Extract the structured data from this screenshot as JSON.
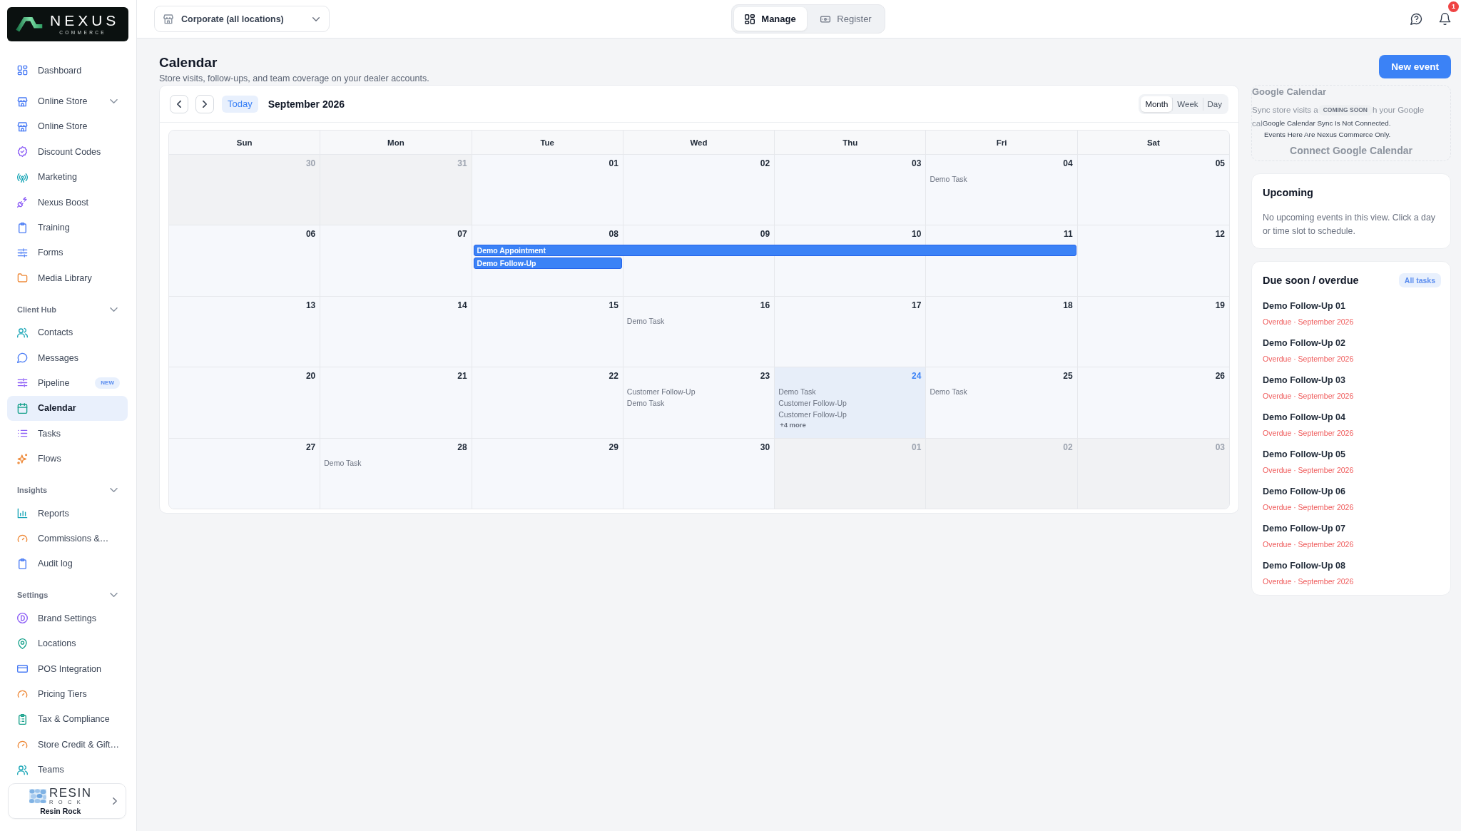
{
  "sidebar": {
    "logo": {
      "name": "NEXUS",
      "tagline": "COMMERCE"
    },
    "groups": [
      {
        "kind": "plain",
        "items": [
          {
            "label": "Dashboard",
            "selected": false
          }
        ]
      },
      {
        "kind": "menu",
        "label": "Online Store",
        "expanded": true,
        "items": [
          {
            "label": "Online Store",
            "selected": false
          },
          {
            "label": "Discount Codes",
            "selected": false
          },
          {
            "label": "Marketing",
            "selected": false
          },
          {
            "label": "Nexus Boost",
            "selected": false
          },
          {
            "label": "Training",
            "selected": false
          },
          {
            "label": "Forms",
            "selected": false
          },
          {
            "label": "Media Library",
            "selected": false
          }
        ]
      },
      {
        "kind": "section",
        "label": "Client Hub",
        "expanded": true,
        "items": [
          {
            "label": "Contacts",
            "selected": false
          },
          {
            "label": "Messages",
            "selected": false
          },
          {
            "label": "Pipeline",
            "selected": false,
            "badge": "NEW"
          },
          {
            "label": "Calendar",
            "selected": true
          },
          {
            "label": "Tasks",
            "selected": false
          },
          {
            "label": "Flows",
            "selected": false
          }
        ]
      },
      {
        "kind": "section",
        "label": "Insights",
        "expanded": true,
        "items": [
          {
            "label": "Reports",
            "selected": false
          },
          {
            "label": "Commissions &…",
            "selected": false
          },
          {
            "label": "Audit log",
            "selected": false
          }
        ]
      },
      {
        "kind": "section",
        "label": "Settings",
        "expanded": true,
        "items": [
          {
            "label": "Brand Settings",
            "selected": false
          },
          {
            "label": "Locations",
            "selected": false
          },
          {
            "label": "POS Integration",
            "selected": false
          },
          {
            "label": "Pricing Tiers",
            "selected": false
          },
          {
            "label": "Tax & Compliance",
            "selected": false
          },
          {
            "label": "Store Credit & Gift…",
            "selected": false
          },
          {
            "label": "Teams",
            "selected": false
          }
        ]
      }
    ],
    "account": {
      "logo_name": "RESIN",
      "logo_tagline": "ROCK",
      "name": "Resin Rock"
    }
  },
  "topbar": {
    "location": "Corporate (all locations)",
    "modes": [
      {
        "label": "Manage",
        "selected": true
      },
      {
        "label": "Register",
        "selected": false
      }
    ],
    "notifications": "1"
  },
  "page": {
    "title": "Calendar",
    "subtitle": "Store visits, follow-ups, and team coverage on your dealer accounts.",
    "new_button": "New event"
  },
  "calendar": {
    "today_button": "Today",
    "month_label": "September 2026",
    "views": [
      {
        "label": "Month",
        "selected": true
      },
      {
        "label": "Week",
        "selected": false
      },
      {
        "label": "Day",
        "selected": false
      }
    ],
    "weekdays": [
      "Sun",
      "Mon",
      "Tue",
      "Wed",
      "Thu",
      "Fri",
      "Sat"
    ],
    "weeks": [
      {
        "days": [
          {
            "date": "30",
            "outside": true,
            "today": false
          },
          {
            "date": "31",
            "outside": true,
            "today": false
          },
          {
            "date": "01",
            "outside": false,
            "today": false
          },
          {
            "date": "02",
            "outside": false,
            "today": false
          },
          {
            "date": "03",
            "outside": false,
            "today": false
          },
          {
            "date": "04",
            "outside": false,
            "today": false,
            "events": [
              "Demo Task"
            ]
          },
          {
            "date": "05",
            "outside": false,
            "today": false
          }
        ]
      },
      {
        "days": [
          {
            "date": "06",
            "outside": false,
            "today": false
          },
          {
            "date": "07",
            "outside": false,
            "today": false
          },
          {
            "date": "08",
            "outside": false,
            "today": false
          },
          {
            "date": "09",
            "outside": false,
            "today": false
          },
          {
            "date": "10",
            "outside": false,
            "today": false
          },
          {
            "date": "11",
            "outside": false,
            "today": false
          },
          {
            "date": "12",
            "outside": false,
            "today": false
          }
        ],
        "lanes": [
          {
            "slots": [
              {
                "kind": "free"
              },
              {
                "kind": "free"
              },
              {
                "kind": "bar",
                "title": "Demo Appointment"
              },
              {
                "kind": "cont"
              },
              {
                "kind": "cont"
              },
              {
                "kind": "cont"
              },
              {
                "kind": "free"
              }
            ]
          },
          {
            "slots": [
              {
                "kind": "free"
              },
              {
                "kind": "free"
              },
              {
                "kind": "bar",
                "title": "Demo Follow-Up"
              },
              {
                "kind": "free"
              },
              {
                "kind": "free"
              },
              {
                "kind": "free"
              },
              {
                "kind": "free"
              }
            ]
          }
        ]
      },
      {
        "days": [
          {
            "date": "13",
            "outside": false,
            "today": false
          },
          {
            "date": "14",
            "outside": false,
            "today": false
          },
          {
            "date": "15",
            "outside": false,
            "today": false
          },
          {
            "date": "16",
            "outside": false,
            "today": false,
            "events": [
              "Demo Task"
            ]
          },
          {
            "date": "17",
            "outside": false,
            "today": false
          },
          {
            "date": "18",
            "outside": false,
            "today": false
          },
          {
            "date": "19",
            "outside": false,
            "today": false
          }
        ]
      },
      {
        "days": [
          {
            "date": "20",
            "outside": false,
            "today": false
          },
          {
            "date": "21",
            "outside": false,
            "today": false
          },
          {
            "date": "22",
            "outside": false,
            "today": false
          },
          {
            "date": "23",
            "outside": false,
            "today": false,
            "events": [
              "Customer Follow-Up",
              "Demo Task"
            ]
          },
          {
            "date": "24",
            "outside": false,
            "today": true,
            "events": [
              "Demo Task",
              "Customer Follow-Up",
              "Customer Follow-Up"
            ],
            "more": "+4 more"
          },
          {
            "date": "25",
            "outside": false,
            "today": false,
            "events": [
              "Demo Task"
            ]
          },
          {
            "date": "26",
            "outside": false,
            "today": false
          }
        ]
      },
      {
        "days": [
          {
            "date": "27",
            "outside": false,
            "today": false
          },
          {
            "date": "28",
            "outside": false,
            "today": false,
            "events": [
              "Demo Task"
            ]
          },
          {
            "date": "29",
            "outside": false,
            "today": false
          },
          {
            "date": "30",
            "outside": false,
            "today": false
          },
          {
            "date": "01",
            "outside": true,
            "today": false
          },
          {
            "date": "02",
            "outside": true,
            "today": false
          },
          {
            "date": "03",
            "outside": true,
            "today": false
          }
        ]
      }
    ]
  },
  "google_calendar": {
    "disabled": true,
    "title": "Google Calendar",
    "description_fragments": [
      "Sync store visits a",
      "h your Google",
      "cal"
    ],
    "badge": "COMING SOON",
    "notice": [
      "Google Calendar Sync Is Not Connected.",
      "Events Here Are Nexus Commerce Only."
    ],
    "button": "Connect Google Calendar"
  },
  "upcoming": {
    "title": "Upcoming",
    "empty_text": "No upcoming events in this view. Click a day or time slot to schedule."
  },
  "due": {
    "title": "Due soon / overdue",
    "link": "All tasks",
    "items": [
      {
        "title": "Demo Follow-Up 01",
        "status": "Overdue · September 2026"
      },
      {
        "title": "Demo Follow-Up 02",
        "status": "Overdue · September 2026"
      },
      {
        "title": "Demo Follow-Up 03",
        "status": "Overdue · September 2026"
      },
      {
        "title": "Demo Follow-Up 04",
        "status": "Overdue · September 2026"
      },
      {
        "title": "Demo Follow-Up 05",
        "status": "Overdue · September 2026"
      },
      {
        "title": "Demo Follow-Up 06",
        "status": "Overdue · September 2026"
      },
      {
        "title": "Demo Follow-Up 07",
        "status": "Overdue · September 2026"
      },
      {
        "title": "Demo Follow-Up 08",
        "status": "Overdue · September 2026"
      }
    ]
  }
}
